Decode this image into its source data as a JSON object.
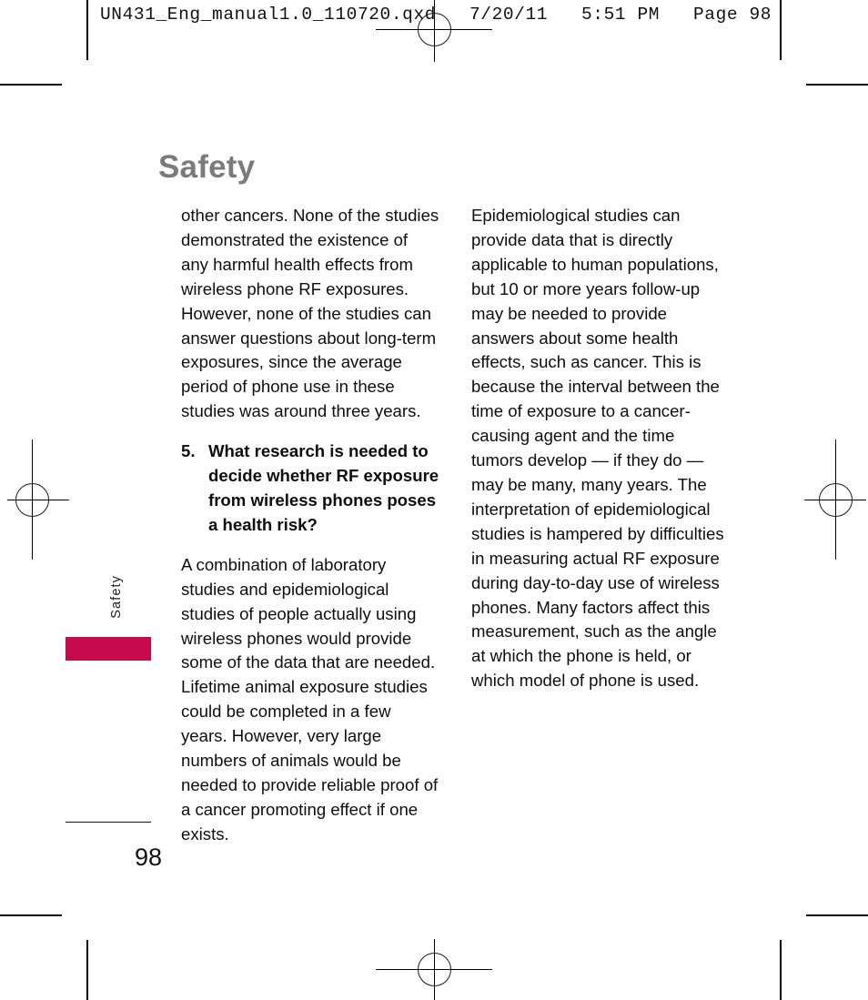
{
  "document": {
    "prepress_header": "UN431_Eng_manual1.0_110720.qxd   7/20/11   5:51 PM   Page 98",
    "page_title": "Safety",
    "side_tab_label": "Safety",
    "page_number": "98",
    "accent_color": "#C60A4B",
    "title_color": "#7B7B7B",
    "body_color": "#0E0E0E"
  },
  "columns": {
    "left": {
      "paragraph_1": "other cancers. None of the studies demonstrated the existence of any harmful health effects from wireless phone RF exposures. However, none of the studies can answer questions about long-term exposures, since the average period of phone use in these studies was around three years.",
      "numbered_item": {
        "number": "5.",
        "text": "What research is needed to decide whether RF exposure from wireless phones poses a health risk?"
      },
      "paragraph_2": "A combination of laboratory studies and epidemiological studies of people actually using wireless phones would provide some of the data that are needed. Lifetime animal exposure studies could be completed in a few years. However, very large numbers of animals would be needed to provide reliable proof of a cancer promoting effect if one exists."
    },
    "right": {
      "paragraph_1": "Epidemiological studies can provide data that is directly applicable to human populations, but 10 or more years follow-up may be needed to provide answers about some health effects, such as cancer. This is because the interval between the time of exposure to a cancer-causing agent and the time tumors develop — if they do — may be many, many years. The interpretation of epidemiological studies is hampered by difficulties in measuring actual RF exposure during day-to-day use of wireless phones. Many factors affect this measurement, such as the angle at which the phone is held, or which model of phone is used."
    }
  }
}
